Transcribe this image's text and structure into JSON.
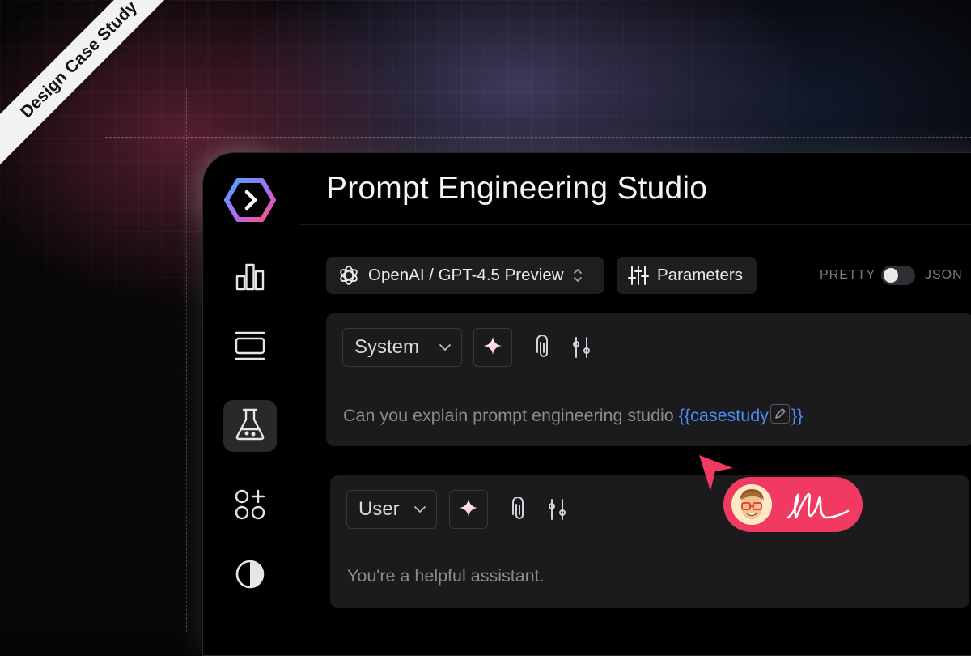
{
  "ribbon": {
    "text": "Design Case Study"
  },
  "app": {
    "title": "Prompt Engineering Studio",
    "sidebar": {
      "items": [
        {
          "icon": "logo-hexagon-icon",
          "active": false
        },
        {
          "icon": "bar-chart-icon",
          "active": false
        },
        {
          "icon": "layout-list-icon",
          "active": false
        },
        {
          "icon": "flask-icon",
          "active": true
        },
        {
          "icon": "add-shapes-icon",
          "active": false
        },
        {
          "icon": "contrast-icon",
          "active": false
        }
      ]
    },
    "toolbar": {
      "model_label": "OpenAI / GPT-4.5 Preview",
      "model_icon": "openai-icon",
      "parameters_label": "Parameters",
      "parameters_icon": "sliders-icon",
      "pretty_label": "PRETTY",
      "json_label": "JSON",
      "toggle_on": false
    },
    "messages": [
      {
        "role": "System",
        "text": "Can you explain prompt engineering studio",
        "variable_open": "{{casestudy",
        "variable_close": "}}"
      },
      {
        "role": "User",
        "text": "You're a helpful assistant."
      }
    ],
    "colors": {
      "accent_blue": "#4a8ef5",
      "badge_pink": "#f03a62",
      "background": "#000000",
      "card": "#1b1b1d"
    }
  }
}
